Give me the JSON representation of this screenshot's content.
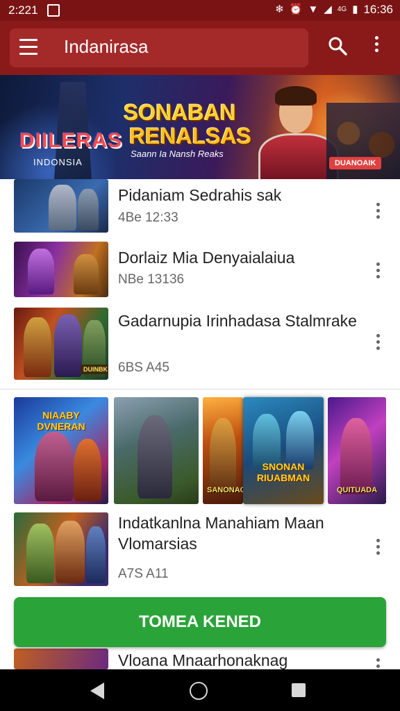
{
  "status_bar": {
    "time_left": "2:221",
    "time_right": "16:36",
    "signal_text": "4G"
  },
  "app_bar": {
    "title": "Indanirasa",
    "menu_icon": "menu-icon",
    "search_icon": "search-icon",
    "overflow_icon": "more-vert-icon"
  },
  "banner": {
    "logo_text": "DIILERAS",
    "logo_sub": "INDONSIA",
    "headline_1": "SONABAN",
    "headline_2": "RENALSAS",
    "tagline": "Saann Ia Nansh Reaks",
    "badge": "DUANOAIK"
  },
  "items": [
    {
      "title": "Pidaniam Sedrahis sak",
      "meta": "4Be 12:33"
    },
    {
      "title": "Dorlaiz Mia Denyaialaiua",
      "meta": "NBe 13136"
    },
    {
      "title": "Gadarnupia Irinhadasa Stalmrake",
      "meta": "6BS A45",
      "thumb_caption": "DUINBK"
    },
    {
      "title": "Indatkanlna Manahiam Maan Vlomarsias",
      "meta": "A7S A11"
    },
    {
      "title": "Vloana Mnaarhonaknag",
      "meta": ""
    }
  ],
  "gallery": [
    {
      "top": "NIAABY DVNERAN",
      "label": ""
    },
    {
      "top": "",
      "label": ""
    },
    {
      "top": "",
      "label": "SANONAO"
    },
    {
      "top": "SNONAN RIUABMAN",
      "label": ""
    },
    {
      "top": "",
      "label": "QUITUADA"
    }
  ],
  "primary_button": {
    "label": "TOMEA KENED"
  },
  "colors": {
    "app_bar": "#8a1a1a",
    "status_bar": "#7a1414",
    "button_green": "#2aa438"
  }
}
